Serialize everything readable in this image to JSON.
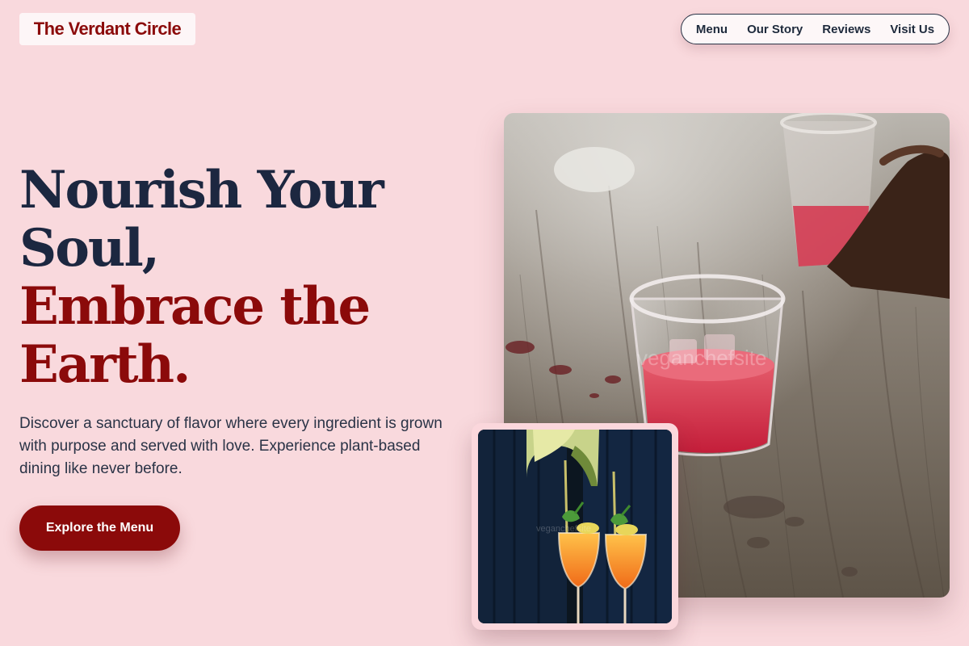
{
  "brand": {
    "name": "The Verdant Circle"
  },
  "nav": {
    "items": [
      {
        "label": "Menu"
      },
      {
        "label": "Our Story"
      },
      {
        "label": "Reviews"
      },
      {
        "label": "Visit Us"
      }
    ]
  },
  "hero": {
    "headline_line1": "Nourish Your",
    "headline_line2": "Soul,",
    "headline_line3": "Embrace the",
    "headline_line4": "Earth.",
    "description": "Discover a sanctuary of flavor where every ingredient is grown with purpose and served with love. Experience plant-based dining like never before.",
    "cta_label": "Explore the Menu"
  },
  "images": {
    "main": {
      "watermark": "veganchefsite"
    },
    "secondary": {
      "watermark": "veganchefsite"
    }
  },
  "colors": {
    "background": "#f9d9dd",
    "accent": "#8b0a0a",
    "heading_dark": "#1c2740"
  }
}
